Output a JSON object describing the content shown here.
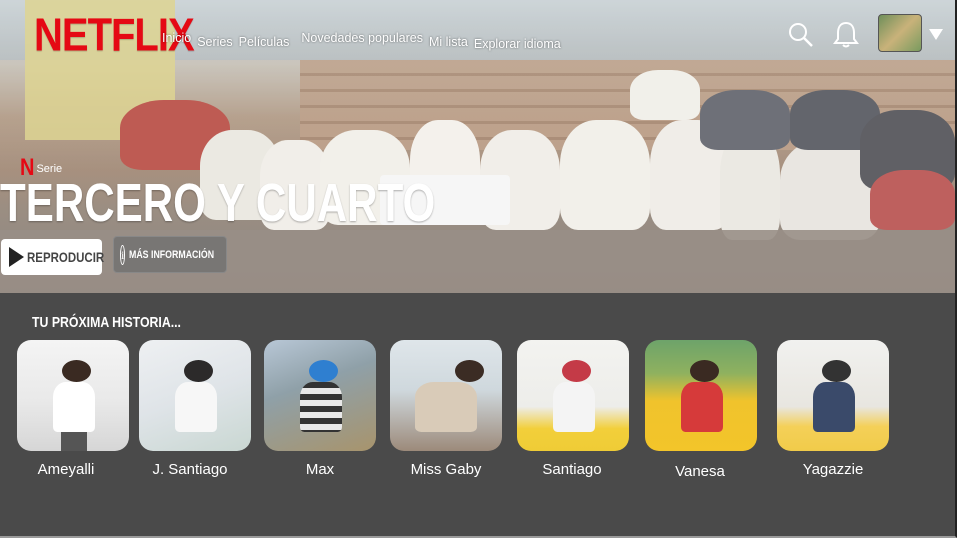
{
  "header": {
    "logo": "NETFLIX",
    "nav": [
      "Inicio",
      "Series",
      "Películas",
      "Novedades populares",
      "Mi lista",
      "Explorar idioma"
    ]
  },
  "hero": {
    "badge_letter": "N",
    "badge_text": "Serie",
    "title": "TERCERO Y CUARTO",
    "play_label": "REPRODUCIR",
    "info_label": "MÁS INFORMACIÓN",
    "info_icon_glyph": "i"
  },
  "row": {
    "title": "TU PRÓXIMA HISTORIA...",
    "items": [
      {
        "name": "Ameyalli"
      },
      {
        "name": "J. Santiago"
      },
      {
        "name": "Max"
      },
      {
        "name": "Miss Gaby"
      },
      {
        "name": "Santiago"
      },
      {
        "name": "Vanesa"
      },
      {
        "name": "Yagazzie"
      }
    ]
  },
  "icons": [
    "search-icon",
    "bell-icon",
    "profile-avatar",
    "caret-down-icon",
    "play-icon",
    "info-icon"
  ],
  "colors": {
    "brand_red": "#e50914",
    "row_background": "#4a4a4a",
    "text": "#ffffff"
  }
}
